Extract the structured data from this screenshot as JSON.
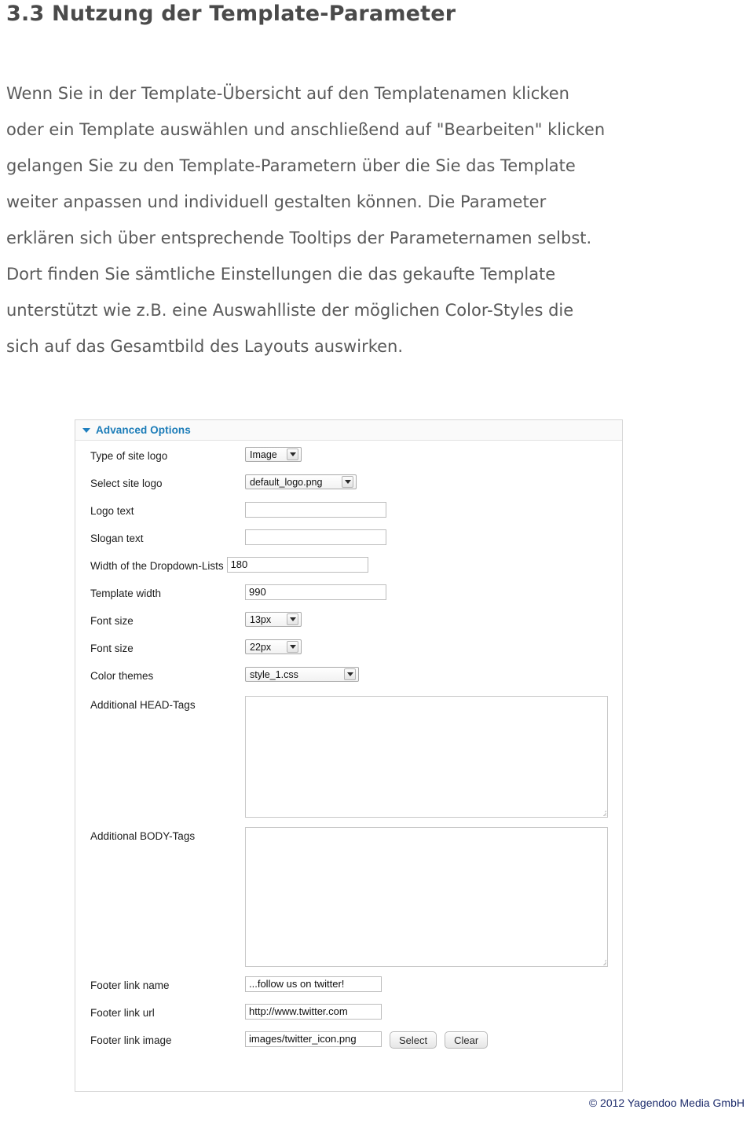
{
  "document": {
    "heading": "3.3 Nutzung der Template-Parameter",
    "paragraph_lines": [
      "Wenn Sie in der Template-Übersicht auf den Templatenamen klicken",
      "oder ein Template auswählen und anschließend auf \"Bearbeiten\" klicken",
      "gelangen Sie zu den Template-Parametern über die Sie das Template",
      "weiter anpassen und individuell gestalten können. Die Parameter",
      "erklären sich über    entsprechende Tooltips der Parameternamen selbst.",
      "Dort finden Sie sämtliche Einstellungen die das gekaufte Template",
      "unterstützt wie z.B. eine Auswahlliste der möglichen Color-Styles die",
      "sich auf das Gesamtbild des Layouts auswirken."
    ],
    "copyright": "© 2012 Yagendoo Media GmbH"
  },
  "screenshot": {
    "panel": {
      "title": "Advanced Options",
      "disclosure_icon": "triangle-down-icon",
      "title_color": "#1b7cb8"
    },
    "fields": {
      "type_of_site_logo": {
        "label": "Type of site logo",
        "control": "select",
        "value": "Image"
      },
      "select_site_logo": {
        "label": "Select site logo",
        "control": "select",
        "value": "default_logo.png"
      },
      "logo_text": {
        "label": "Logo text",
        "control": "text",
        "value": ""
      },
      "slogan_text": {
        "label": "Slogan text",
        "control": "text",
        "value": ""
      },
      "dropdown_width": {
        "label": "Width of the Dropdown-Lists",
        "control": "text",
        "value": "180"
      },
      "template_width": {
        "label": "Template width",
        "control": "text",
        "value": "990"
      },
      "font_size_1": {
        "label": "Font size",
        "control": "select",
        "value": "13px"
      },
      "font_size_2": {
        "label": "Font size",
        "control": "select",
        "value": "22px"
      },
      "color_themes": {
        "label": "Color themes",
        "control": "select",
        "value": "style_1.css"
      },
      "additional_head_tags": {
        "label": "Additional HEAD-Tags",
        "control": "textarea",
        "value": ""
      },
      "additional_body_tags": {
        "label": "Additional BODY-Tags",
        "control": "textarea",
        "value": ""
      },
      "footer_link_name": {
        "label": "Footer link name",
        "control": "text",
        "value": "...follow us on twitter!"
      },
      "footer_link_url": {
        "label": "Footer link url",
        "control": "text",
        "value": "http://www.twitter.com"
      },
      "footer_link_image": {
        "label": "Footer link image",
        "control": "text",
        "value": "images/twitter_icon.png"
      }
    },
    "buttons": {
      "select": "Select",
      "clear": "Clear"
    }
  }
}
